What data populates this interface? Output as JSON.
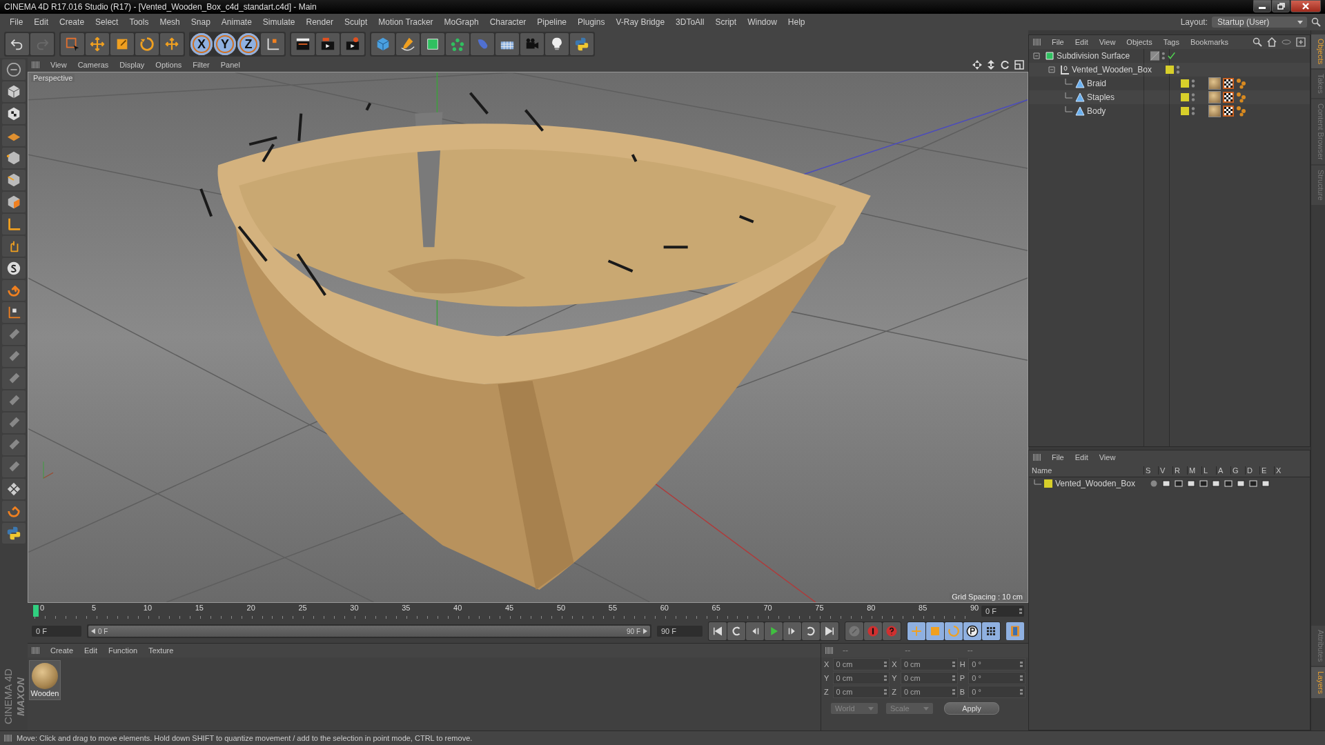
{
  "window": {
    "title": "CINEMA 4D R17.016 Studio (R17) - [Vented_Wooden_Box_c4d_standart.c4d] - Main"
  },
  "menu": [
    "File",
    "Edit",
    "Create",
    "Select",
    "Tools",
    "Mesh",
    "Snap",
    "Animate",
    "Simulate",
    "Render",
    "Sculpt",
    "Motion Tracker",
    "MoGraph",
    "Character",
    "Pipeline",
    "Plugins",
    "V-Ray Bridge",
    "3DToAll",
    "Script",
    "Window",
    "Help"
  ],
  "layout": {
    "label": "Layout:",
    "value": "Startup (User)"
  },
  "axis_buttons": [
    {
      "label": "X",
      "selected": true
    },
    {
      "label": "Y",
      "selected": true
    },
    {
      "label": "Z",
      "selected": true
    }
  ],
  "viewport": {
    "menu": [
      "View",
      "Cameras",
      "Display",
      "Options",
      "Filter",
      "Panel"
    ],
    "camera": "Perspective",
    "grid_spacing": "Grid Spacing : 10 cm"
  },
  "timeline": {
    "ticks": [
      "0",
      "5",
      "10",
      "15",
      "20",
      "25",
      "30",
      "35",
      "40",
      "45",
      "50",
      "55",
      "60",
      "65",
      "70",
      "75",
      "80",
      "85",
      "90"
    ],
    "current": "0 F",
    "start": "0 F",
    "range": {
      "start": "0 F",
      "end": "90 F",
      "level": 1
    },
    "end": "90 F"
  },
  "material_manager": {
    "menu": [
      "Create",
      "Edit",
      "Function",
      "Texture"
    ],
    "materials": [
      {
        "name": "Wooden"
      }
    ]
  },
  "coordinates": {
    "headers": [
      "--",
      "--",
      "--"
    ],
    "rows": [
      {
        "cells": [
          {
            "axis": "X",
            "value": "0 cm"
          },
          {
            "axis": "X",
            "value": "0 cm"
          },
          {
            "axis": "H",
            "value": "0 °"
          }
        ]
      },
      {
        "cells": [
          {
            "axis": "Y",
            "value": "0 cm"
          },
          {
            "axis": "Y",
            "value": "0 cm"
          },
          {
            "axis": "P",
            "value": "0 °"
          }
        ]
      },
      {
        "cells": [
          {
            "axis": "Z",
            "value": "0 cm"
          },
          {
            "axis": "Z",
            "value": "0 cm"
          },
          {
            "axis": "B",
            "value": "0 °"
          }
        ]
      }
    ],
    "dropdowns": [
      "World",
      "Scale"
    ],
    "apply": "Apply"
  },
  "object_manager": {
    "menu": [
      "File",
      "Edit",
      "View",
      "Objects",
      "Tags",
      "Bookmarks"
    ],
    "objects": [
      {
        "name": "Subdivision Surface",
        "kind": "generator",
        "children": [
          {
            "name": "Vented_Wooden_Box",
            "kind": "null",
            "color": "#d8cf2a",
            "children": [
              {
                "name": "Braid",
                "kind": "polygon",
                "color": "#d8cf2a",
                "tags": [
                  {
                    "kind": "material"
                  },
                  {
                    "kind": "texture"
                  },
                  {
                    "kind": "points"
                  }
                ]
              },
              {
                "name": "Staples",
                "kind": "polygon",
                "color": "#d8cf2a",
                "tags": [
                  {
                    "kind": "material"
                  },
                  {
                    "kind": "texture"
                  },
                  {
                    "kind": "points"
                  }
                ]
              },
              {
                "name": "Body",
                "kind": "polygon",
                "color": "#d8cf2a",
                "tags": [
                  {
                    "kind": "material"
                  },
                  {
                    "kind": "texture"
                  },
                  {
                    "kind": "points"
                  }
                ]
              }
            ]
          }
        ]
      }
    ]
  },
  "layer_manager": {
    "menu": [
      "File",
      "Edit",
      "View"
    ],
    "columns": [
      "Name",
      "S",
      "V",
      "R",
      "M",
      "L",
      "A",
      "G",
      "D",
      "E",
      "X"
    ],
    "layers": [
      {
        "name": "Vented_Wooden_Box",
        "color": "#d8cf2a"
      }
    ]
  },
  "side_tabs_top": [
    {
      "label": "Objects",
      "selected": true
    },
    {
      "label": "Takes",
      "selected": false
    },
    {
      "label": "Content Browser",
      "selected": false
    },
    {
      "label": "Structure",
      "selected": false
    }
  ],
  "side_tabs_bottom": [
    {
      "label": "Attributes",
      "selected": false
    },
    {
      "label": "Layers",
      "selected": true
    }
  ],
  "brand": {
    "maker": "MAXON",
    "product": "CINEMA 4D"
  },
  "status_bar": "Move: Click and drag to move elements. Hold down SHIFT to quantize movement / add to the selection in point mode, CTRL to remove."
}
